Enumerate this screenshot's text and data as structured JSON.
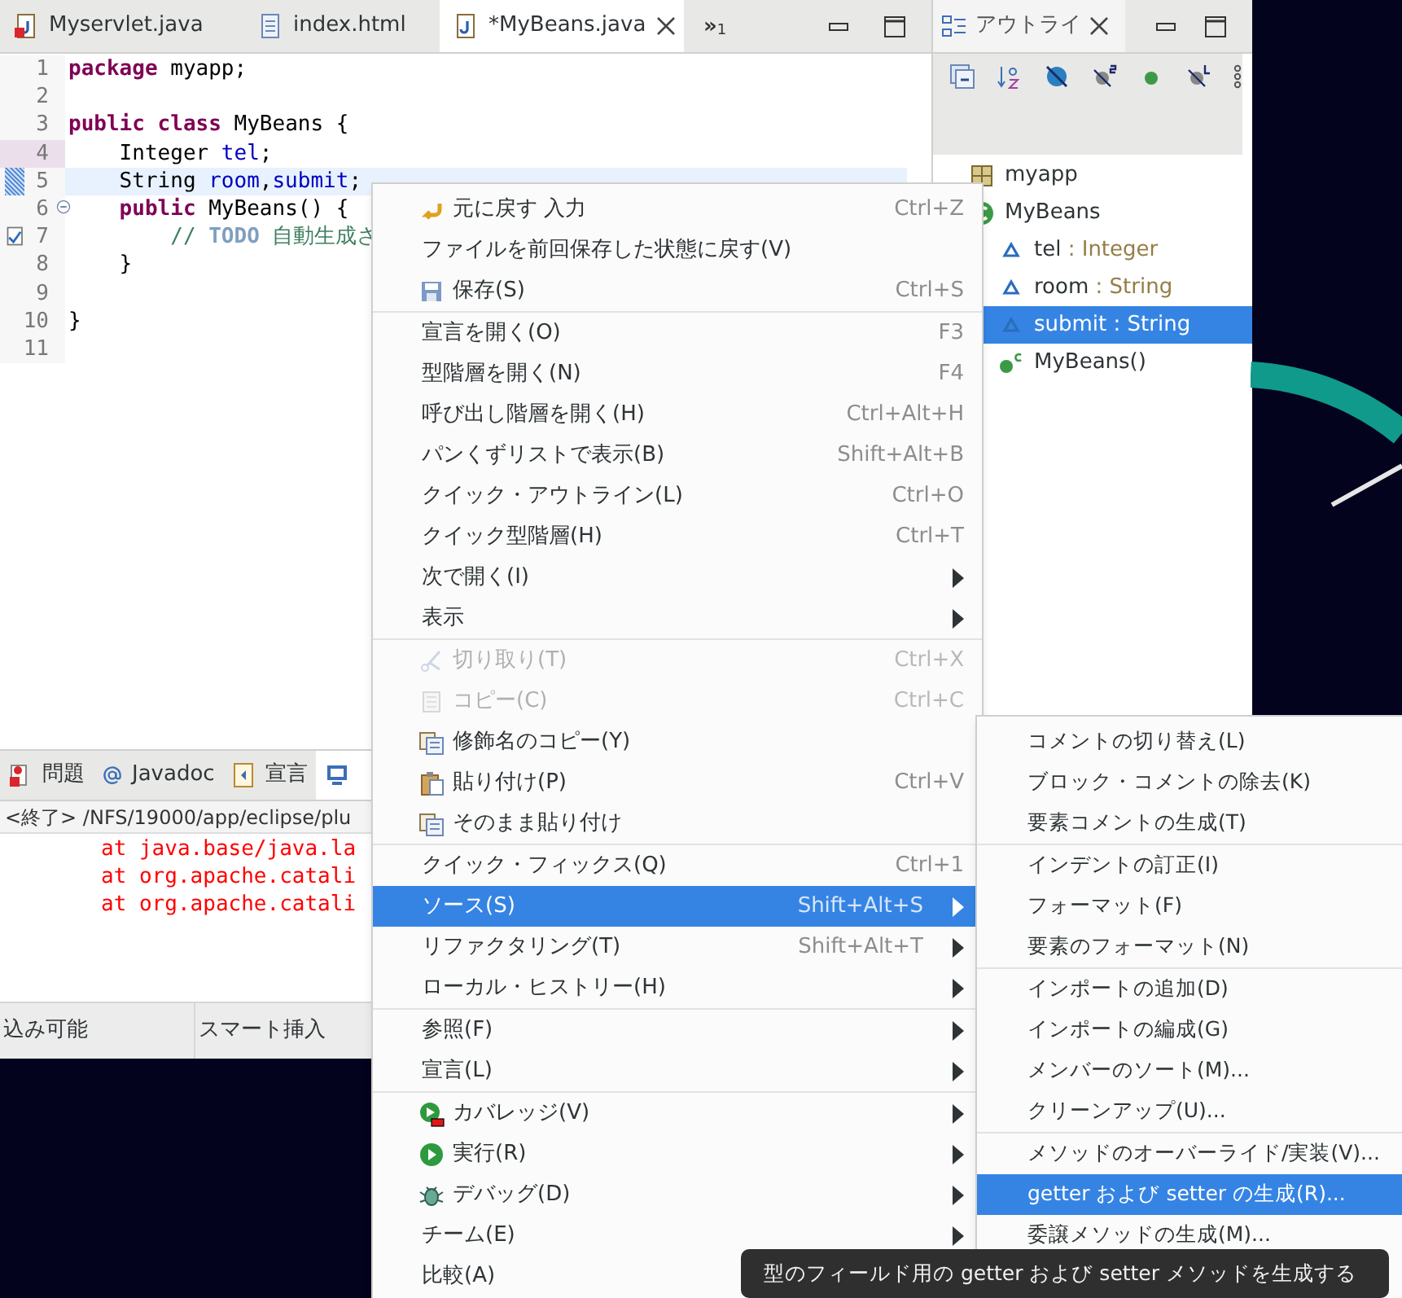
{
  "editor": {
    "tabs": [
      {
        "label": "Myservlet.java",
        "kind": "java-error",
        "selected": false,
        "closable": false
      },
      {
        "label": "index.html",
        "kind": "html",
        "selected": false,
        "closable": false
      },
      {
        "label": "*MyBeans.java",
        "kind": "java",
        "selected": true,
        "closable": true
      }
    ],
    "overflow": {
      "symbol": "»",
      "count": "1"
    },
    "lines": [
      {
        "number": "1",
        "highlighted": false,
        "tokens": [
          {
            "kind": "keyword",
            "text": "package"
          },
          {
            "kind": "plain",
            "text": " myapp;"
          }
        ]
      },
      {
        "number": "2",
        "highlighted": false
      },
      {
        "number": "3",
        "highlighted": false,
        "tokens": [
          {
            "kind": "keyword",
            "text": "public"
          },
          {
            "kind": "keyword",
            "text": " class"
          },
          {
            "kind": "plain",
            "text": " MyBeans {"
          }
        ]
      },
      {
        "number": "4",
        "highlighted": false,
        "kind": "occurrence",
        "tokens": [
          {
            "kind": "plain",
            "text": "    Integer "
          },
          {
            "kind": "field",
            "text": "tel"
          },
          {
            "kind": "plain",
            "text": ";"
          }
        ]
      },
      {
        "number": "5",
        "highlighted": true,
        "kind": "selection",
        "tokens": [
          {
            "kind": "plain",
            "text": "    String "
          },
          {
            "kind": "field",
            "text": "room"
          },
          {
            "kind": "plain",
            "text": ","
          },
          {
            "kind": "field",
            "text": "submit"
          },
          {
            "kind": "plain",
            "text": ";"
          }
        ]
      },
      {
        "number": "6",
        "highlighted": false,
        "kind": "fold",
        "tokens": [
          {
            "kind": "keyword",
            "text": "    public"
          },
          {
            "kind": "plain",
            "text": " MyBeans() {"
          }
        ]
      },
      {
        "number": "7",
        "highlighted": false,
        "kind": "task",
        "tokens": [
          {
            "kind": "comment",
            "text": "        // "
          },
          {
            "kind": "todo",
            "text": "TODO"
          },
          {
            "kind": "comment",
            "text": " 自動生成さ"
          }
        ]
      },
      {
        "number": "8",
        "highlighted": false,
        "tokens": [
          {
            "kind": "plain",
            "text": "    }"
          }
        ]
      },
      {
        "number": "9",
        "highlighted": false
      },
      {
        "number": "10",
        "highlighted": false,
        "tokens": [
          {
            "kind": "plain",
            "text": "}"
          }
        ]
      },
      {
        "number": "11",
        "highlighted": false
      }
    ]
  },
  "outline": {
    "tab": {
      "label": "アウトライ",
      "selected": true
    },
    "tree": [
      {
        "label": "myapp",
        "kind": "package",
        "selected": false
      },
      {
        "label": "MyBeans",
        "kind": "class",
        "selected": false,
        "children": [
          {
            "label": "tel",
            "type": " : Integer",
            "kind": "field",
            "selected": false
          },
          {
            "label": "room",
            "type": " : String",
            "kind": "field",
            "selected": false
          },
          {
            "label": "submit",
            "type": " : String",
            "kind": "field",
            "selected": true
          },
          {
            "label": "MyBeans()",
            "kind": "constructor",
            "selected": false
          }
        ]
      }
    ]
  },
  "bottom_panel": {
    "tabs": [
      {
        "label": "問題",
        "kind": "problems",
        "selected": false
      },
      {
        "label": "Javadoc",
        "kind": "at",
        "selected": false
      },
      {
        "label": "宣言",
        "kind": "declaration",
        "selected": false
      },
      {
        "kind": "console",
        "selected": true
      }
    ],
    "process": "<終了> /NFS/19000/app/eclipse/plu",
    "console_lines": [
      "at java.base/java.la",
      "at org.apache.catali",
      "at org.apache.catali"
    ]
  },
  "status_bar": [
    "込み可能",
    "スマート挿入"
  ],
  "context_menu": {
    "groups": [
      [
        {
          "label": "元に戻す 入力",
          "kind": "undo",
          "shortcut": "Ctrl+Z",
          "submenu": false,
          "disabled": false,
          "selected": false
        },
        {
          "label": "ファイルを前回保存した状態に戻す(V)",
          "disabled": false,
          "selected": false
        },
        {
          "label": "保存(S)",
          "kind": "save",
          "shortcut": "Ctrl+S",
          "submenu": false,
          "disabled": false,
          "selected": false
        }
      ],
      [
        {
          "label": "宣言を開く(O)",
          "shortcut": "F3",
          "submenu": false,
          "disabled": false,
          "selected": false
        },
        {
          "label": "型階層を開く(N)",
          "shortcut": "F4",
          "submenu": false,
          "disabled": false,
          "selected": false
        },
        {
          "label": "呼び出し階層を開く(H)",
          "shortcut": "Ctrl+Alt+H",
          "submenu": false,
          "disabled": false,
          "selected": false
        },
        {
          "label": "パンくずリストで表示(B)",
          "shortcut": "Shift+Alt+B",
          "submenu": false,
          "disabled": false,
          "selected": false
        },
        {
          "label": "クイック・アウトライン(L)",
          "shortcut": "Ctrl+O",
          "submenu": false,
          "disabled": false,
          "selected": false
        },
        {
          "label": "クイック型階層(H)",
          "shortcut": "Ctrl+T",
          "submenu": false,
          "disabled": false,
          "selected": false
        },
        {
          "label": "次で開く(I)",
          "submenu": true,
          "disabled": false,
          "selected": false
        },
        {
          "label": "表示",
          "submenu": true,
          "disabled": false,
          "selected": false
        }
      ],
      [
        {
          "label": "切り取り(T)",
          "kind": "cut",
          "shortcut": "Ctrl+X",
          "submenu": false,
          "disabled": true,
          "selected": false
        },
        {
          "label": "コピー(C)",
          "kind": "copy",
          "shortcut": "Ctrl+C",
          "submenu": false,
          "disabled": true,
          "selected": false
        },
        {
          "label": "修飾名のコピー(Y)",
          "kind": "copy-qualified",
          "submenu": false,
          "disabled": false,
          "selected": false
        },
        {
          "label": "貼り付け(P)",
          "kind": "paste",
          "shortcut": "Ctrl+V",
          "submenu": false,
          "disabled": false,
          "selected": false
        },
        {
          "label": "そのまま貼り付け",
          "kind": "copy-qualified",
          "submenu": false,
          "disabled": false,
          "selected": false
        }
      ],
      [
        {
          "label": "クイック・フィックス(Q)",
          "shortcut": "Ctrl+1",
          "submenu": false,
          "disabled": false,
          "selected": false
        },
        {
          "label": "ソース(S)",
          "shortcut": "Shift+Alt+S",
          "submenu": true,
          "disabled": false,
          "selected": true
        },
        {
          "label": "リファクタリング(T)",
          "shortcut": "Shift+Alt+T",
          "submenu": true,
          "disabled": false,
          "selected": false
        },
        {
          "label": "ローカル・ヒストリー(H)",
          "submenu": true,
          "disabled": false,
          "selected": false
        }
      ],
      [
        {
          "label": "参照(F)",
          "submenu": true,
          "disabled": false,
          "selected": false
        },
        {
          "label": "宣言(L)",
          "submenu": true,
          "disabled": false,
          "selected": false
        }
      ],
      [
        {
          "label": "カバレッジ(V)",
          "kind": "coverage",
          "submenu": true,
          "disabled": false,
          "selected": false
        },
        {
          "label": "実行(R)",
          "kind": "run",
          "submenu": true,
          "disabled": false,
          "selected": false
        },
        {
          "label": "デバッグ(D)",
          "kind": "debug",
          "submenu": true,
          "disabled": false,
          "selected": false
        },
        {
          "label": "チーム(E)",
          "submenu": true,
          "disabled": false,
          "selected": false
        },
        {
          "label": "比較(A)",
          "disabled": false,
          "selected": false
        }
      ]
    ]
  },
  "submenu": {
    "groups": [
      [
        {
          "label": "コメントの切り替え(L)",
          "selected": false
        },
        {
          "label": "ブロック・コメントの除去(K)",
          "selected": false
        },
        {
          "label": "要素コメントの生成(T)",
          "selected": false
        }
      ],
      [
        {
          "label": "インデントの訂正(I)",
          "selected": false
        },
        {
          "label": "フォーマット(F)",
          "selected": false
        },
        {
          "label": "要素のフォーマット(N)",
          "selected": false
        }
      ],
      [
        {
          "label": "インポートの追加(D)",
          "selected": false
        },
        {
          "label": "インポートの編成(G)",
          "selected": false
        },
        {
          "label": "メンバーのソート(M)...",
          "selected": false
        },
        {
          "label": "クリーンアップ(U)...",
          "selected": false
        }
      ],
      [
        {
          "label": "メソッドのオーバーライド/実装(V)...",
          "selected": false
        },
        {
          "label": "getter および setter の生成(R)...",
          "selected": true
        },
        {
          "label": "委譲メソッドの生成(M)...",
          "selected": false
        }
      ]
    ]
  },
  "tooltip": "型のフィールド用の getter および setter メソッドを生成する"
}
